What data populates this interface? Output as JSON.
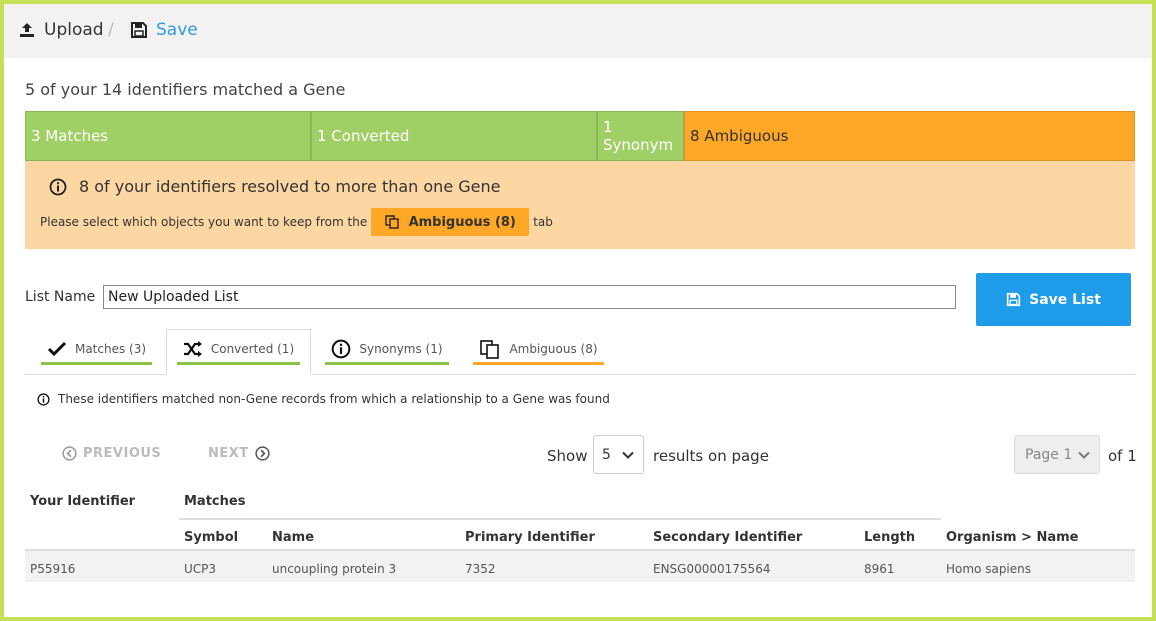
{
  "breadcrumb": {
    "upload_label": "Upload",
    "separator": "/",
    "save_label": "Save"
  },
  "summary": {
    "title": "5 of your 14 identifiers matched a Gene",
    "segments": {
      "matches": "3 Matches",
      "converted": "1 Converted",
      "synonym": "1 Synonym",
      "ambiguous": "8 Ambiguous"
    }
  },
  "alert": {
    "heading": "8 of your identifiers resolved to more than one Gene",
    "text_before": "Please select which objects you want to keep from the",
    "button_label": "Ambiguous (8)",
    "text_after": "tab"
  },
  "list": {
    "name_label": "List Name",
    "name_value": "New Uploaded List",
    "save_button": "Save List"
  },
  "tabs": {
    "matches": "Matches (3)",
    "converted": "Converted (1)",
    "synonyms": "Synonyms (1)",
    "ambiguous": "Ambiguous (8)"
  },
  "info_text": "These identifiers matched non-Gene records from which a relationship to a Gene was found",
  "pagination": {
    "previous": "PREVIOUS",
    "next": "NEXT",
    "show": "Show",
    "per_page": "5",
    "results_on_page": "results on page",
    "page": "Page 1",
    "of": "of 1"
  },
  "table": {
    "your_identifier_header": "Your Identifier",
    "matches_header": "Matches",
    "columns": {
      "symbol": "Symbol",
      "name": "Name",
      "primary": "Primary Identifier",
      "secondary": "Secondary Identifier",
      "length": "Length",
      "organism": "Organism > Name"
    },
    "rows": [
      {
        "your_identifier": "P55916",
        "symbol": "UCP3",
        "name": "uncoupling protein 3",
        "primary": "7352",
        "secondary": "ENSG00000175564",
        "length": "8961",
        "organism": "Homo sapiens"
      }
    ]
  },
  "colors": {
    "frame": "#c5e055",
    "green": "#9fcf65",
    "orange": "#ffa726",
    "alert_bg": "#fdd7a3",
    "blue": "#1e9be9",
    "link": "#2f9ad8"
  }
}
